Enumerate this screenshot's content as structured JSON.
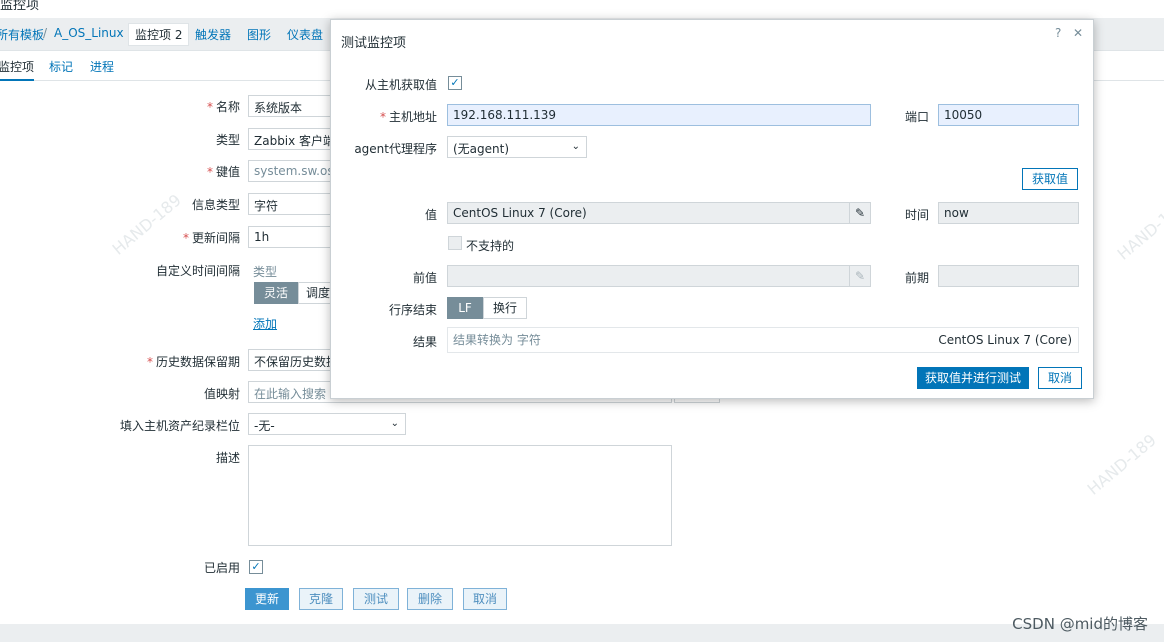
{
  "window": {
    "title": "监控项"
  },
  "breadcrumb": {
    "items": [
      {
        "label": "所有模板"
      },
      {
        "label": "A_OS_Linux"
      },
      {
        "label": "监控项 2"
      },
      {
        "label": "触发器"
      },
      {
        "label": "图形"
      },
      {
        "label": "仪表盘"
      }
    ],
    "separator": "/"
  },
  "subtabs": [
    "监控项",
    "标记",
    "进程"
  ],
  "form": {
    "name": {
      "label": "名称",
      "value": "系统版本"
    },
    "type": {
      "label": "类型",
      "value": "Zabbix 客户端"
    },
    "key": {
      "label": "键值",
      "value": "system.sw.os[n"
    },
    "info_type": {
      "label": "信息类型",
      "value": "字符"
    },
    "update_interval": {
      "label": "更新间隔",
      "value": "1h"
    },
    "custom_intervals": {
      "label": "自定义时间间隔",
      "column": "类型",
      "flexible": "灵活",
      "scheduling": "调度",
      "add": "添加"
    },
    "history": {
      "label": "历史数据保留期",
      "value": "不保留历史数据"
    },
    "value_map": {
      "label": "值映射",
      "placeholder": "在此输入搜索"
    },
    "inventory": {
      "label": "填入主机资产纪录栏位",
      "value": "-无-"
    },
    "description": {
      "label": "描述"
    },
    "enabled": {
      "label": "已启用",
      "check": "✓"
    },
    "buttons": {
      "update": "更新",
      "clone": "克隆",
      "test": "测试",
      "delete": "删除",
      "cancel": "取消"
    }
  },
  "modal": {
    "title": "测试监控项",
    "help_icon": "?",
    "close_icon": "✕",
    "get_from_host": {
      "label": "从主机获取值",
      "check": "✓"
    },
    "host_address": {
      "label": "主机地址",
      "value": "192.168.111.139"
    },
    "port": {
      "label": "端口",
      "value": "10050"
    },
    "agent_proxy": {
      "label": "agent代理程序",
      "value": "(无agent)"
    },
    "get_value_button": "获取值",
    "value": {
      "label": "值",
      "value": "CentOS Linux 7 (Core)"
    },
    "time": {
      "label": "时间",
      "value": "now"
    },
    "not_supported": {
      "label": "不支持的"
    },
    "prev_value": {
      "label": "前值"
    },
    "prev_time": {
      "label": "前期"
    },
    "eol": {
      "label": "行序结束",
      "lf": "LF",
      "crlf": "换行"
    },
    "result": {
      "label": "结果",
      "note": "结果转换为 字符",
      "value": "CentOS Linux 7 (Core)"
    },
    "submit_button": "获取值并进行测试",
    "cancel_button": "取消"
  },
  "watermark_text": "HAND-189",
  "footer_credit": "CSDN @mid的博客"
}
